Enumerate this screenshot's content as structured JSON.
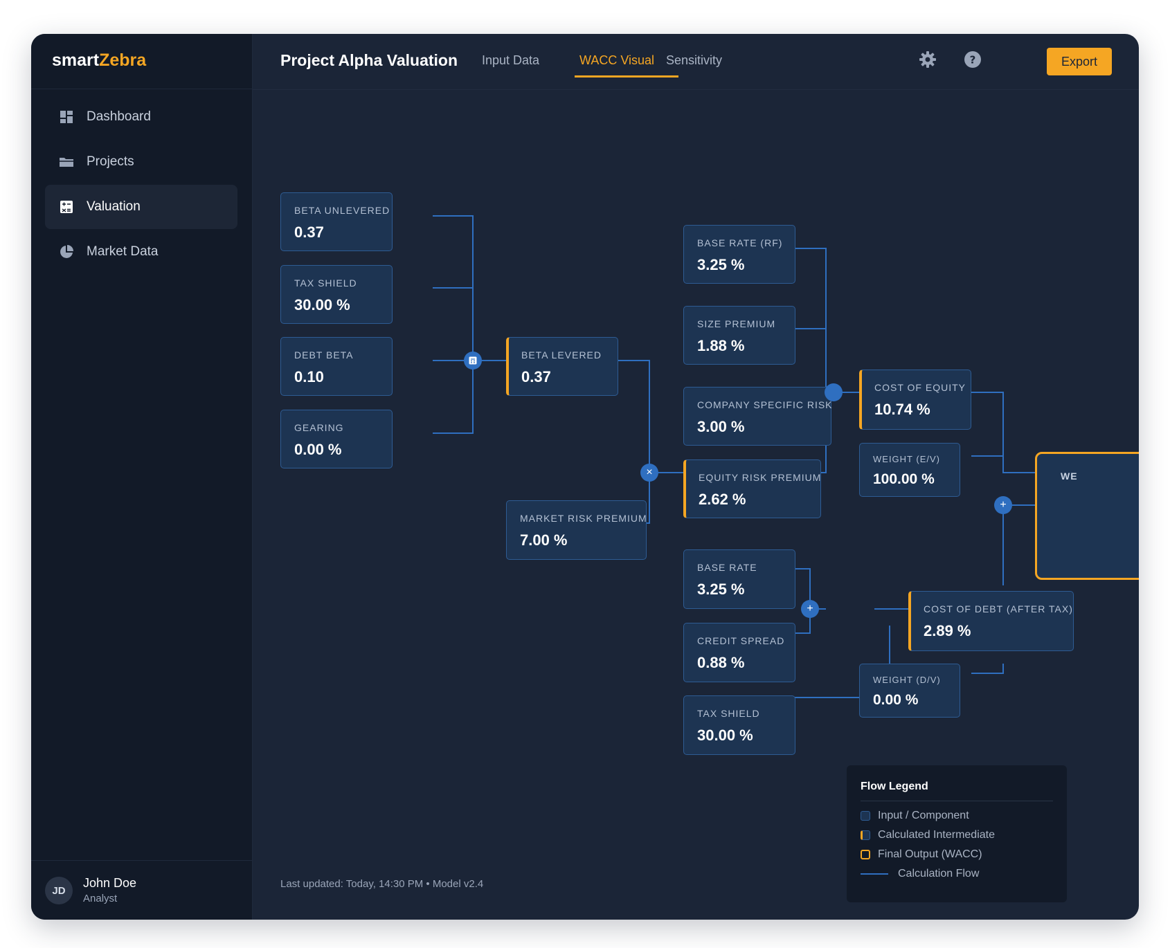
{
  "brand": {
    "prefix": "smart",
    "accent": "Zebra"
  },
  "nav": {
    "items": [
      {
        "label": "Dashboard",
        "icon": "dashboard-icon"
      },
      {
        "label": "Projects",
        "icon": "folder-icon"
      },
      {
        "label": "Valuation",
        "icon": "calculator-icon",
        "active": true
      },
      {
        "label": "Market Data",
        "icon": "pie-chart-icon"
      }
    ]
  },
  "user": {
    "initials": "JD",
    "name": "John Doe",
    "role": "Analyst"
  },
  "header": {
    "title": "Project Alpha Valuation",
    "tabs": [
      {
        "label": "Input Data"
      },
      {
        "label": "WACC Visual",
        "active": true
      },
      {
        "label": "Sensitivity"
      }
    ],
    "export_label": "Export"
  },
  "nodes": {
    "beta_unlevered": {
      "label": "BETA UNLEVERED",
      "value": "0.37"
    },
    "tax_shield_1": {
      "label": "TAX SHIELD",
      "value": "30.00 %"
    },
    "debt_beta": {
      "label": "DEBT BETA",
      "value": "0.10"
    },
    "gearing": {
      "label": "GEARING",
      "value": "0.00 %"
    },
    "beta_levered": {
      "label": "BETA LEVERED",
      "value": "0.37"
    },
    "market_risk_premium": {
      "label": "MARKET RISK PREMIUM",
      "value": "7.00 %"
    },
    "base_rate_rf": {
      "label": "BASE RATE (RF)",
      "value": "3.25 %"
    },
    "size_premium": {
      "label": "SIZE PREMIUM",
      "value": "1.88 %"
    },
    "company_specific_risk": {
      "label": "COMPANY SPECIFIC RISK",
      "value": "3.00 %"
    },
    "equity_risk_premium": {
      "label": "EQUITY RISK PREMIUM",
      "value": "2.62 %"
    },
    "base_rate": {
      "label": "BASE RATE",
      "value": "3.25 %"
    },
    "credit_spread": {
      "label": "CREDIT SPREAD",
      "value": "0.88 %"
    },
    "tax_shield_2": {
      "label": "TAX SHIELD",
      "value": "30.00 %"
    },
    "cost_of_equity": {
      "label": "COST OF EQUITY",
      "value": "10.74 %"
    },
    "weight_ev": {
      "label": "WEIGHT (E/V)",
      "value": "100.00 %"
    },
    "cost_of_debt": {
      "label": "COST OF DEBT (AFTER TAX)",
      "value": "2.89 %"
    },
    "weight_dv": {
      "label": "WEIGHT (D/V)",
      "value": "0.00 %"
    },
    "wacc": {
      "label": "WE"
    }
  },
  "operators": {
    "multiply": "×",
    "plus": "+"
  },
  "footer": {
    "note": "Last updated: Today, 14:30 PM • Model v2.4"
  },
  "legend": {
    "title": "Flow Legend",
    "items": [
      {
        "label": "Input / Component",
        "kind": "input"
      },
      {
        "label": "Calculated Intermediate",
        "kind": "calc"
      },
      {
        "label": "Final Output (WACC)",
        "kind": "final"
      },
      {
        "label": "Calculation Flow",
        "kind": "line"
      }
    ]
  },
  "colors": {
    "accent": "#f5a623",
    "node_bg": "#1d3452",
    "node_border": "#2e5c94",
    "flow_line": "#2f6fc0",
    "background": "#1b2537",
    "sidebar": "#121a28"
  }
}
